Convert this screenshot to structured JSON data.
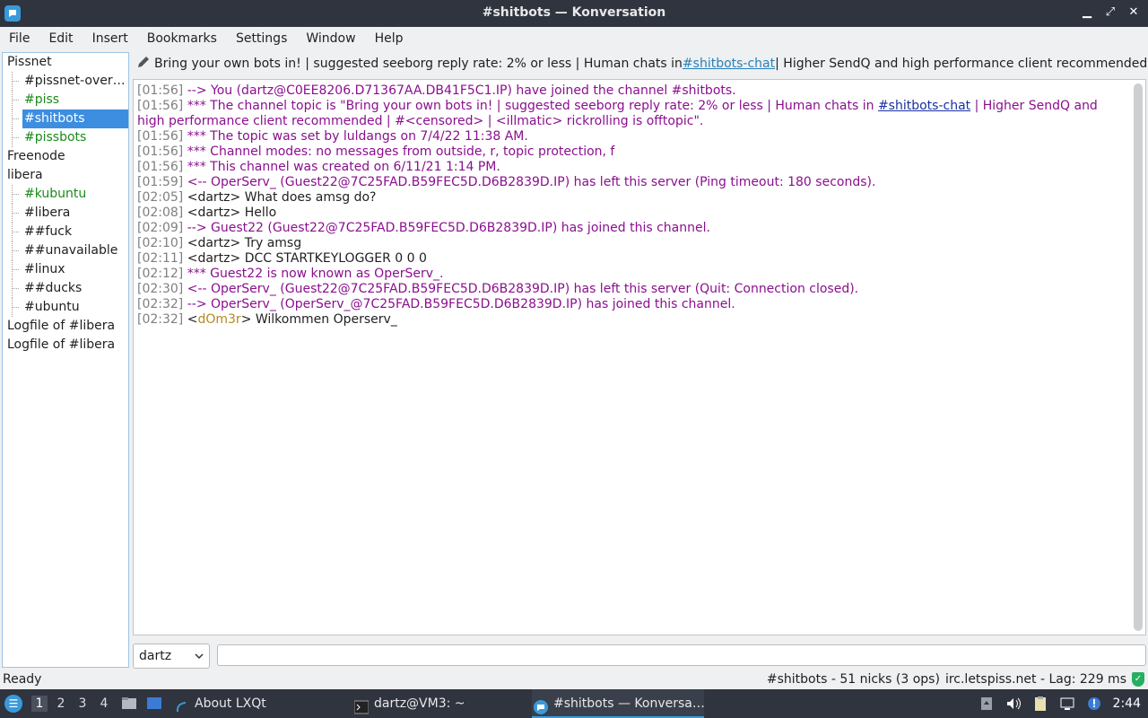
{
  "window": {
    "title": "#shitbots — Konversation"
  },
  "menu": [
    "File",
    "Edit",
    "Insert",
    "Bookmarks",
    "Settings",
    "Window",
    "Help"
  ],
  "sidebar": {
    "items": [
      {
        "label": "Pissnet",
        "level": 0,
        "color": "default"
      },
      {
        "label": "#pissnet-over…",
        "level": 1,
        "color": "default"
      },
      {
        "label": "#piss",
        "level": 1,
        "color": "green"
      },
      {
        "label": "#shitbots",
        "level": 1,
        "color": "selected"
      },
      {
        "label": "#pissbots",
        "level": 1,
        "color": "green"
      },
      {
        "label": "Freenode",
        "level": 0,
        "color": "default"
      },
      {
        "label": "libera",
        "level": 0,
        "color": "default"
      },
      {
        "label": "#kubuntu",
        "level": 1,
        "color": "green"
      },
      {
        "label": "#libera",
        "level": 1,
        "color": "default"
      },
      {
        "label": "##fuck",
        "level": 1,
        "color": "default"
      },
      {
        "label": "##unavailable",
        "level": 1,
        "color": "default"
      },
      {
        "label": "#linux",
        "level": 1,
        "color": "default"
      },
      {
        "label": "##ducks",
        "level": 1,
        "color": "default"
      },
      {
        "label": "#ubuntu",
        "level": 1,
        "color": "default"
      },
      {
        "label": "Logfile of #libera",
        "level": 0,
        "color": "default"
      },
      {
        "label": "Logfile of #libera",
        "level": 0,
        "color": "default"
      }
    ]
  },
  "topic": {
    "before": "Bring your own bots in! | suggested seeborg reply rate: 2% or less | Human chats in ",
    "link": "#shitbots-chat",
    "after": " | Higher SendQ and high performance client recommended | ..."
  },
  "chat": {
    "lines": [
      {
        "ts": "[01:56]",
        "kind": "sys",
        "text": " --> You (dartz@C0EE8206.D71367AA.DB41F5C1.IP) have joined the channel #shitbots."
      },
      {
        "ts": "[01:56]",
        "kind": "topic",
        "text": " *** The channel topic is \"Bring your own bots in! | suggested seeborg reply rate: 2% or less | Human chats in ",
        "link": "#shitbots-chat",
        "after": " | Higher SendQ and high performance client recommended | #<censored> | <illmatic> rickrolling is offtopic\"."
      },
      {
        "ts": "[01:56]",
        "kind": "sys",
        "text": " *** The topic was set by luldangs on 7/4/22 11:38 AM."
      },
      {
        "ts": "[01:56]",
        "kind": "sys",
        "text": " *** Channel modes: no messages from outside, r, topic protection, f"
      },
      {
        "ts": "[01:56]",
        "kind": "sys",
        "text": " *** This channel was created on 6/11/21 1:14 PM."
      },
      {
        "ts": "[01:59]",
        "kind": "sys",
        "text": " <-- OperServ_ (Guest22@7C25FAD.B59FEC5D.D6B2839D.IP) has left this server (Ping timeout: 180 seconds)."
      },
      {
        "ts": "[02:05]",
        "kind": "msg",
        "text": " <dartz> What does amsg do?"
      },
      {
        "ts": "[02:08]",
        "kind": "msg",
        "text": " <dartz> Hello"
      },
      {
        "ts": "[02:09]",
        "kind": "sys",
        "text": " --> Guest22 (Guest22@7C25FAD.B59FEC5D.D6B2839D.IP) has joined this channel."
      },
      {
        "ts": "[02:10]",
        "kind": "msg",
        "text": " <dartz> Try amsg"
      },
      {
        "ts": "[02:11]",
        "kind": "msg",
        "text": " <dartz> DCC STARTKEYLOGGER 0 0 0"
      },
      {
        "ts": "[02:12]",
        "kind": "sys",
        "text": " *** Guest22 is now known as OperServ_."
      },
      {
        "ts": "[02:30]",
        "kind": "sys",
        "text": " <-- OperServ_ (Guest22@7C25FAD.B59FEC5D.D6B2839D.IP) has left this server (Quit: Connection closed)."
      },
      {
        "ts": "[02:32]",
        "kind": "sys",
        "text": " --> OperServ_ (OperServ_@7C25FAD.B59FEC5D.D6B2839D.IP) has joined this channel."
      },
      {
        "ts": "[02:32]",
        "kind": "nick",
        "pre": " <",
        "nick": "dOm3r",
        "text": "> Wilkommen Operserv_"
      }
    ]
  },
  "input": {
    "nick": "dartz",
    "value": ""
  },
  "status": {
    "left": "Ready",
    "channel_info": "#shitbots - 51 nicks (3 ops)",
    "server_info": "irc.letspiss.net - Lag: 229 ms"
  },
  "taskbar": {
    "desktops": [
      "1",
      "2",
      "3",
      "4"
    ],
    "tasks": [
      {
        "label": "About LXQt",
        "icon": "lxqt-icon"
      },
      {
        "label": "dartz@VM3: ~",
        "icon": "terminal-icon"
      },
      {
        "label": "#shitbots — Konversa…",
        "icon": "konversation-icon"
      }
    ],
    "clock": "2:44"
  },
  "colors": {
    "accent": "#3d8ee0",
    "system_text": "#8b0f8f",
    "active_channel": "#1a8a1a",
    "panel": "#2f343f"
  }
}
